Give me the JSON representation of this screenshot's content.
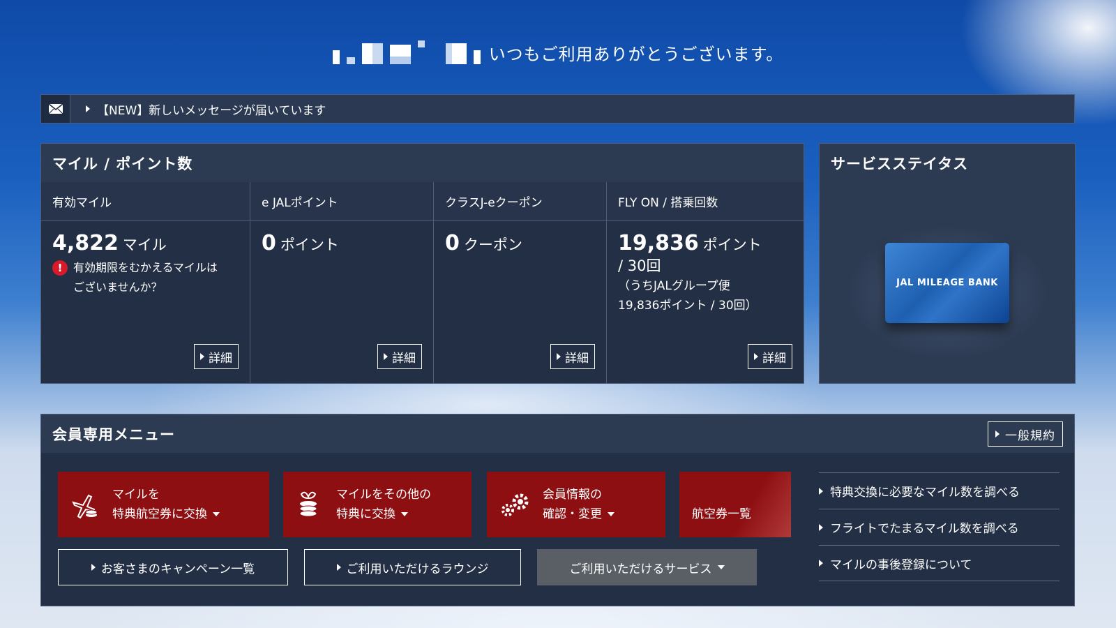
{
  "greeting": {
    "text": "いつもご利用ありがとうございます。"
  },
  "message_bar": {
    "icon": "mail-icon",
    "text": "【NEW】新しいメッセージが届いています"
  },
  "miles_panel": {
    "title": "マイル / ポイント数",
    "columns": [
      {
        "header": "有効マイル",
        "value": "4,822",
        "unit": "マイル",
        "warning_line1": "有効期限をむかえるマイルは",
        "warning_line2": "ございませんか？",
        "detail": "詳細"
      },
      {
        "header": "e JALポイント",
        "value": "0",
        "unit": "ポイント",
        "detail": "詳細"
      },
      {
        "header": "クラスJ-eクーポン",
        "value": "0",
        "unit": "クーポン",
        "detail": "詳細"
      },
      {
        "header": "FLY ON / 搭乗回数",
        "value": "19,836",
        "unit": "ポイント",
        "count": "/ 30回",
        "note_line1": "（うちJALグループ便",
        "note_line2": "19,836ポイント / 30回）",
        "detail": "詳細"
      }
    ]
  },
  "status_panel": {
    "title": "サービスステイタス",
    "card_text": "JAL MILEAGE BANK"
  },
  "member_menu": {
    "title": "会員専用メニュー",
    "terms": "一般規約",
    "buttons": [
      {
        "line1": "マイルを",
        "line2": "特典航空券に交換"
      },
      {
        "line1": "マイルをその他の",
        "line2": "特典に交換"
      },
      {
        "line1": "会員情報の",
        "line2": "確認・変更"
      },
      {
        "line1": "",
        "line2": "航空券一覧"
      }
    ],
    "campaigns": "お客さまのキャンペーン一覧",
    "lounge": "ご利用いただけるラウンジ",
    "services": "ご利用いただけるサービス",
    "links": [
      "特典交換に必要なマイル数を調べる",
      "フライトでたまるマイル数を調べる",
      "マイルの事後登録について"
    ]
  },
  "colors": {
    "panel_bg": "#232f44",
    "panel_head": "#2c3a52",
    "menu_red": "#8e0f12",
    "warning_red": "#d81a2a",
    "service_grey": "#5a5f66"
  }
}
